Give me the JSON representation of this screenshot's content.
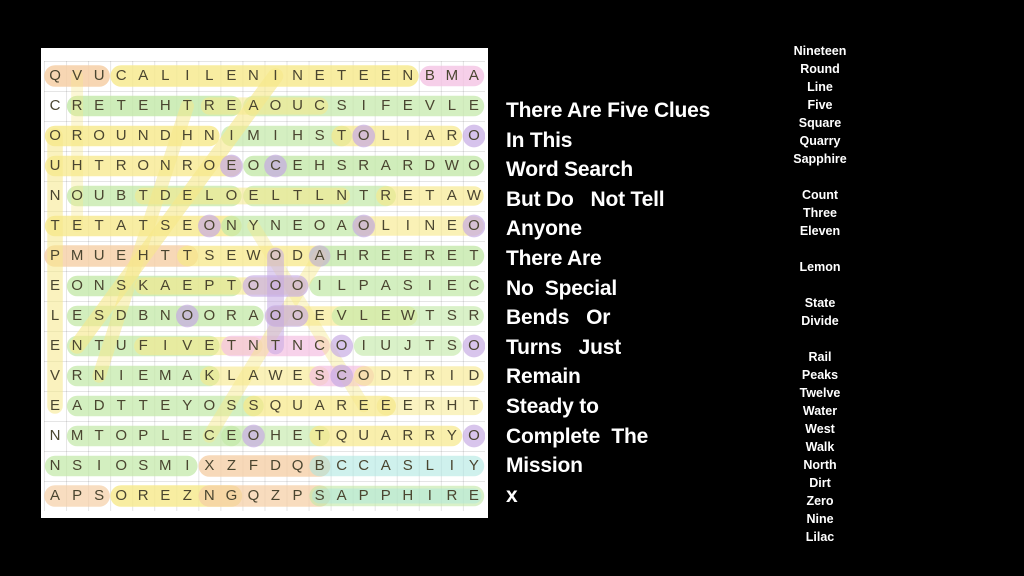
{
  "app": {
    "background_color": "#000000",
    "panel_color": "#ffffff"
  },
  "puzzle": {
    "name": "word-search-grid",
    "rows": 15,
    "cols": 20,
    "letter_color": "#4a4530",
    "grid": [
      "QVUCALILENINETEENBMA",
      "CRETEHTREAOUCSIFEVLE",
      "OROUNDHNIMIHSTOLIARO",
      "UHTRONROEOCEHSRARDWO",
      "NOUBTDELOELTLNTRETAW",
      "TETATSEONYNEOAOLINEO",
      "PMUEHTTSEWODAHREERET",
      "EONSKAEPTOOOILPASIEC",
      "LESDBNOORAOOEVLEWTSR",
      "ENTUFIVETNTNCOIUJTSO",
      "VRNIEMAKLAWESCODTRID",
      "EADTTEYOSSQUAREEERHT",
      "NMTOPLECEOHETQUARRYO",
      "NSIOSMIXZFDQBCCASLIY",
      "APSOREZNGQZPSAPPHIRE"
    ],
    "highlight_colors": {
      "yellow": "#f7e98a",
      "green": "#c3e9a8",
      "purple": "#c6aae4",
      "pink": "#f4c0e2",
      "orange": "#f6cfa6",
      "cyan": "#a9e6e0"
    }
  },
  "message": {
    "name": "clue-message",
    "lines": [
      "There Are Five Clues",
      "In This",
      "Word Search",
      "But Do   Not Tell",
      "Anyone",
      "There Are",
      "No  Special",
      "Bends   Or",
      "Turns   Just",
      "Remain",
      "Steady to",
      "Complete  The",
      "Mission",
      "x"
    ]
  },
  "wordlist": {
    "name": "word-list",
    "groups": [
      [
        "Nineteen",
        "Round",
        "Line",
        "Five",
        "Square",
        "Quarry",
        "Sapphire"
      ],
      [
        "Count",
        "Three",
        "Eleven"
      ],
      [
        "Lemon"
      ],
      [
        "State",
        "Divide"
      ],
      [
        "Rail",
        "Peaks",
        "Twelve",
        "Water",
        "West",
        "Walk",
        "North",
        "Dirt",
        "Zero",
        "Nine",
        "Lilac"
      ]
    ]
  }
}
